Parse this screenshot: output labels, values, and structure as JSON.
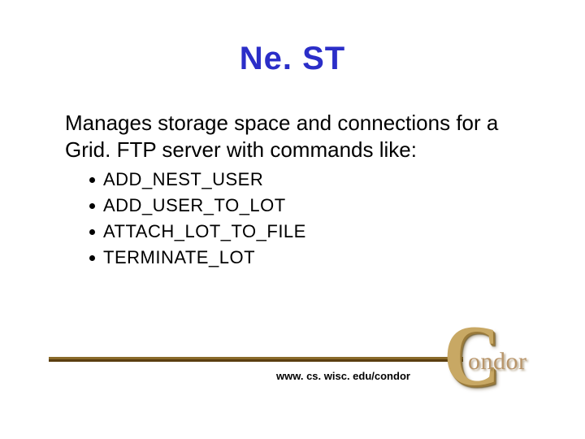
{
  "title": "Ne. ST",
  "intro": "Manages storage space and connections for a Grid. FTP server with commands like:",
  "bullets": [
    "ADD_NEST_USER",
    "ADD_USER_TO_LOT",
    "ATTACH_LOT_TO_FILE",
    "TERMINATE_LOT"
  ],
  "footer_url": "www. cs. wisc. edu/condor",
  "logo": {
    "big_letter": "C",
    "rest": "ondor"
  }
}
